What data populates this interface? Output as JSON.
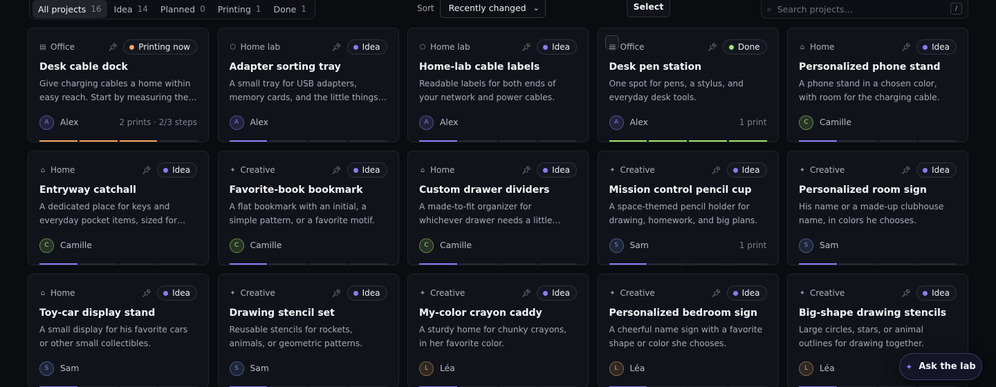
{
  "filters": [
    {
      "label": "All projects",
      "count": "16",
      "active": true
    },
    {
      "label": "Idea",
      "count": "14",
      "active": false
    },
    {
      "label": "Planned",
      "count": "0",
      "active": false
    },
    {
      "label": "Printing",
      "count": "1",
      "active": false
    },
    {
      "label": "Done",
      "count": "1",
      "active": false
    }
  ],
  "sort": {
    "label": "Sort",
    "value": "Recently changed"
  },
  "select_label": "Select",
  "search": {
    "placeholder": "Search projects...",
    "shortcut": "/"
  },
  "assistant_label": "Ask the lab",
  "colors": {
    "idea": "#8b7cf6",
    "printing": "#f5a75a",
    "done": "#9ee66b",
    "avatar_alex": "#8b7cf6",
    "avatar_camille": "#9ee66b",
    "avatar_sam": "#6c8fd8",
    "avatar_lea": "#e0a45a"
  },
  "projects": [
    {
      "category": "Office",
      "icon": "document-icon",
      "status": "Printing now",
      "status_key": "printing",
      "title": "Desk cable dock",
      "description": "Give charging cables a home within easy reach. Start by measuring the desk edge.",
      "owner": "Alex",
      "initial": "A",
      "avatar_key": "avatar_alex",
      "meta": "2 prints · 2/3 steps",
      "progress": 0.75
    },
    {
      "category": "Home lab",
      "icon": "hexagon-icon",
      "status": "Idea",
      "status_key": "idea",
      "title": "Adapter sorting tray",
      "description": "A small tray for USB adapters, memory cards, and the little things that wander off.",
      "owner": "Alex",
      "initial": "A",
      "avatar_key": "avatar_alex",
      "meta": "",
      "progress": 0.25
    },
    {
      "category": "Home lab",
      "icon": "hexagon-icon",
      "status": "Idea",
      "status_key": "idea",
      "title": "Home-lab cable labels",
      "description": "Readable labels for both ends of your network and power cables.",
      "owner": "Alex",
      "initial": "A",
      "avatar_key": "avatar_alex",
      "meta": "",
      "progress": 0.25
    },
    {
      "category": "Office",
      "icon": "document-icon",
      "status": "Done",
      "status_key": "done",
      "title": "Desk pen station",
      "description": "One spot for pens, a stylus, and everyday desk tools.",
      "owner": "Alex",
      "initial": "A",
      "avatar_key": "avatar_alex",
      "meta": "1 print",
      "progress": 1.0
    },
    {
      "category": "Home",
      "icon": "house-icon",
      "status": "Idea",
      "status_key": "idea",
      "title": "Personalized phone stand",
      "description": "A phone stand in a chosen color, with room for the charging cable.",
      "owner": "Camille",
      "initial": "C",
      "avatar_key": "avatar_camille",
      "meta": "",
      "progress": 0.25
    },
    {
      "category": "Home",
      "icon": "house-icon",
      "status": "Idea",
      "status_key": "idea",
      "title": "Entryway catchall",
      "description": "A dedicated place for keys and everyday pocket items, sized for your entryway.",
      "owner": "Camille",
      "initial": "C",
      "avatar_key": "avatar_camille",
      "meta": "",
      "progress": 0.25
    },
    {
      "category": "Creative",
      "icon": "sparkle-icon",
      "status": "Idea",
      "status_key": "idea",
      "title": "Favorite-book bookmark",
      "description": "A flat bookmark with an initial, a simple pattern, or a favorite motif.",
      "owner": "Camille",
      "initial": "C",
      "avatar_key": "avatar_camille",
      "meta": "",
      "progress": 0.25
    },
    {
      "category": "Home",
      "icon": "house-icon",
      "status": "Idea",
      "status_key": "idea",
      "title": "Custom drawer dividers",
      "description": "A made-to-fit organizer for whichever drawer needs a little order.",
      "owner": "Camille",
      "initial": "C",
      "avatar_key": "avatar_camille",
      "meta": "",
      "progress": 0.25
    },
    {
      "category": "Creative",
      "icon": "sparkle-icon",
      "status": "Idea",
      "status_key": "idea",
      "title": "Mission control pencil cup",
      "description": "A space-themed pencil holder for drawing, homework, and big plans.",
      "owner": "Sam",
      "initial": "S",
      "avatar_key": "avatar_sam",
      "meta": "1 print",
      "progress": 0.25
    },
    {
      "category": "Creative",
      "icon": "sparkle-icon",
      "status": "Idea",
      "status_key": "idea",
      "title": "Personalized room sign",
      "description": "His name or a made-up clubhouse name, in colors he chooses.",
      "owner": "Sam",
      "initial": "S",
      "avatar_key": "avatar_sam",
      "meta": "",
      "progress": 0.25
    },
    {
      "category": "Home",
      "icon": "house-icon",
      "status": "Idea",
      "status_key": "idea",
      "title": "Toy-car display stand",
      "description": "A small display for his favorite cars or other small collectibles.",
      "owner": "Sam",
      "initial": "S",
      "avatar_key": "avatar_sam",
      "meta": "",
      "progress": 0.25
    },
    {
      "category": "Creative",
      "icon": "sparkle-icon",
      "status": "Idea",
      "status_key": "idea",
      "title": "Drawing stencil set",
      "description": "Reusable stencils for rockets, animals, or geometric patterns.",
      "owner": "Sam",
      "initial": "S",
      "avatar_key": "avatar_sam",
      "meta": "",
      "progress": 0.25
    },
    {
      "category": "Creative",
      "icon": "sparkle-icon",
      "status": "Idea",
      "status_key": "idea",
      "title": "My-color crayon caddy",
      "description": "A sturdy home for chunky crayons, in her favorite color.",
      "owner": "Léa",
      "initial": "L",
      "avatar_key": "avatar_lea",
      "meta": "",
      "progress": 0.25
    },
    {
      "category": "Creative",
      "icon": "sparkle-icon",
      "status": "Idea",
      "status_key": "idea",
      "title": "Personalized bedroom sign",
      "description": "A cheerful name sign with a favorite shape or color she chooses.",
      "owner": "Léa",
      "initial": "L",
      "avatar_key": "avatar_lea",
      "meta": "",
      "progress": 0.25
    },
    {
      "category": "Creative",
      "icon": "sparkle-icon",
      "status": "Idea",
      "status_key": "idea",
      "title": "Big-shape drawing stencils",
      "description": "Large circles, stars, or animal outlines for drawing together.",
      "owner": "Léa",
      "initial": "L",
      "avatar_key": "avatar_lea",
      "meta": "",
      "progress": 0.25
    }
  ]
}
